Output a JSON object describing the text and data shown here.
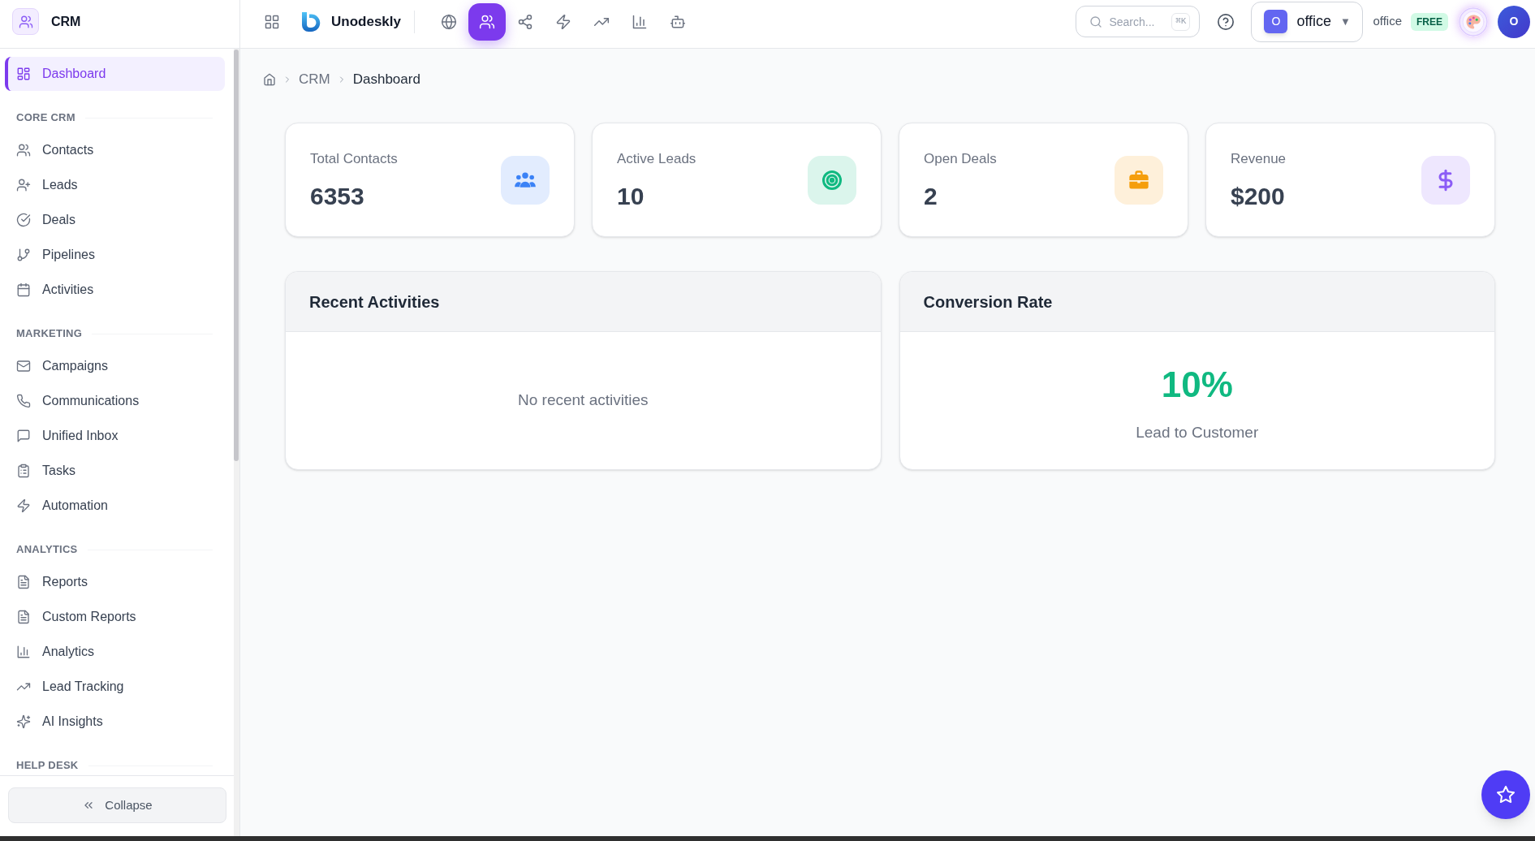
{
  "sidebar": {
    "title": "CRM",
    "items": [
      {
        "label": "Dashboard",
        "selected": true
      }
    ],
    "sections": [
      {
        "heading": "CORE CRM",
        "items": [
          {
            "label": "Contacts",
            "selected": false
          },
          {
            "label": "Leads",
            "selected": false
          },
          {
            "label": "Deals",
            "selected": false
          },
          {
            "label": "Pipelines",
            "selected": false
          },
          {
            "label": "Activities",
            "selected": false
          }
        ]
      },
      {
        "heading": "MARKETING",
        "items": [
          {
            "label": "Campaigns",
            "selected": false
          },
          {
            "label": "Communications",
            "selected": false
          },
          {
            "label": "Unified Inbox",
            "selected": false
          },
          {
            "label": "Tasks",
            "selected": false
          },
          {
            "label": "Automation",
            "selected": false
          }
        ]
      },
      {
        "heading": "ANALYTICS",
        "items": [
          {
            "label": "Reports",
            "selected": false
          },
          {
            "label": "Custom Reports",
            "selected": false
          },
          {
            "label": "Analytics",
            "selected": false
          },
          {
            "label": "Lead Tracking",
            "selected": false
          },
          {
            "label": "AI Insights",
            "selected": false
          }
        ]
      },
      {
        "heading": "HELP DESK"
      }
    ],
    "collapse_button": "Collapse"
  },
  "topbar": {
    "app_name": "Unodeskly",
    "apps": [
      {
        "selected": false
      },
      {
        "selected": true
      },
      {
        "selected": false
      },
      {
        "selected": false
      },
      {
        "selected": false
      },
      {
        "selected": false
      },
      {
        "selected": false
      }
    ],
    "search": {
      "placeholder": "Search...",
      "shortcut": "⌘K"
    },
    "workspace": {
      "initial": "O",
      "name": "office",
      "caret": "▼"
    },
    "user_label": "office",
    "plan_badge": "FREE",
    "avatar_initial": "O"
  },
  "breadcrumb": [
    {
      "label": "CRM",
      "current": false
    },
    {
      "label": "Dashboard",
      "current": true
    }
  ],
  "stats": [
    {
      "label": "Total Contacts",
      "value": "6353",
      "color": "#3b82f6"
    },
    {
      "label": "Active Leads",
      "value": "10",
      "color": "#10b981"
    },
    {
      "label": "Open Deals",
      "value": "2",
      "color": "#f59e0b"
    },
    {
      "label": "Revenue",
      "value": "$200",
      "color": "#8b5cf6"
    }
  ],
  "recent_activities": {
    "title": "Recent Activities",
    "empty_text": "No recent activities"
  },
  "conversion_rate": {
    "title": "Conversion Rate",
    "value": "10%",
    "caption": "Lead to Customer"
  }
}
